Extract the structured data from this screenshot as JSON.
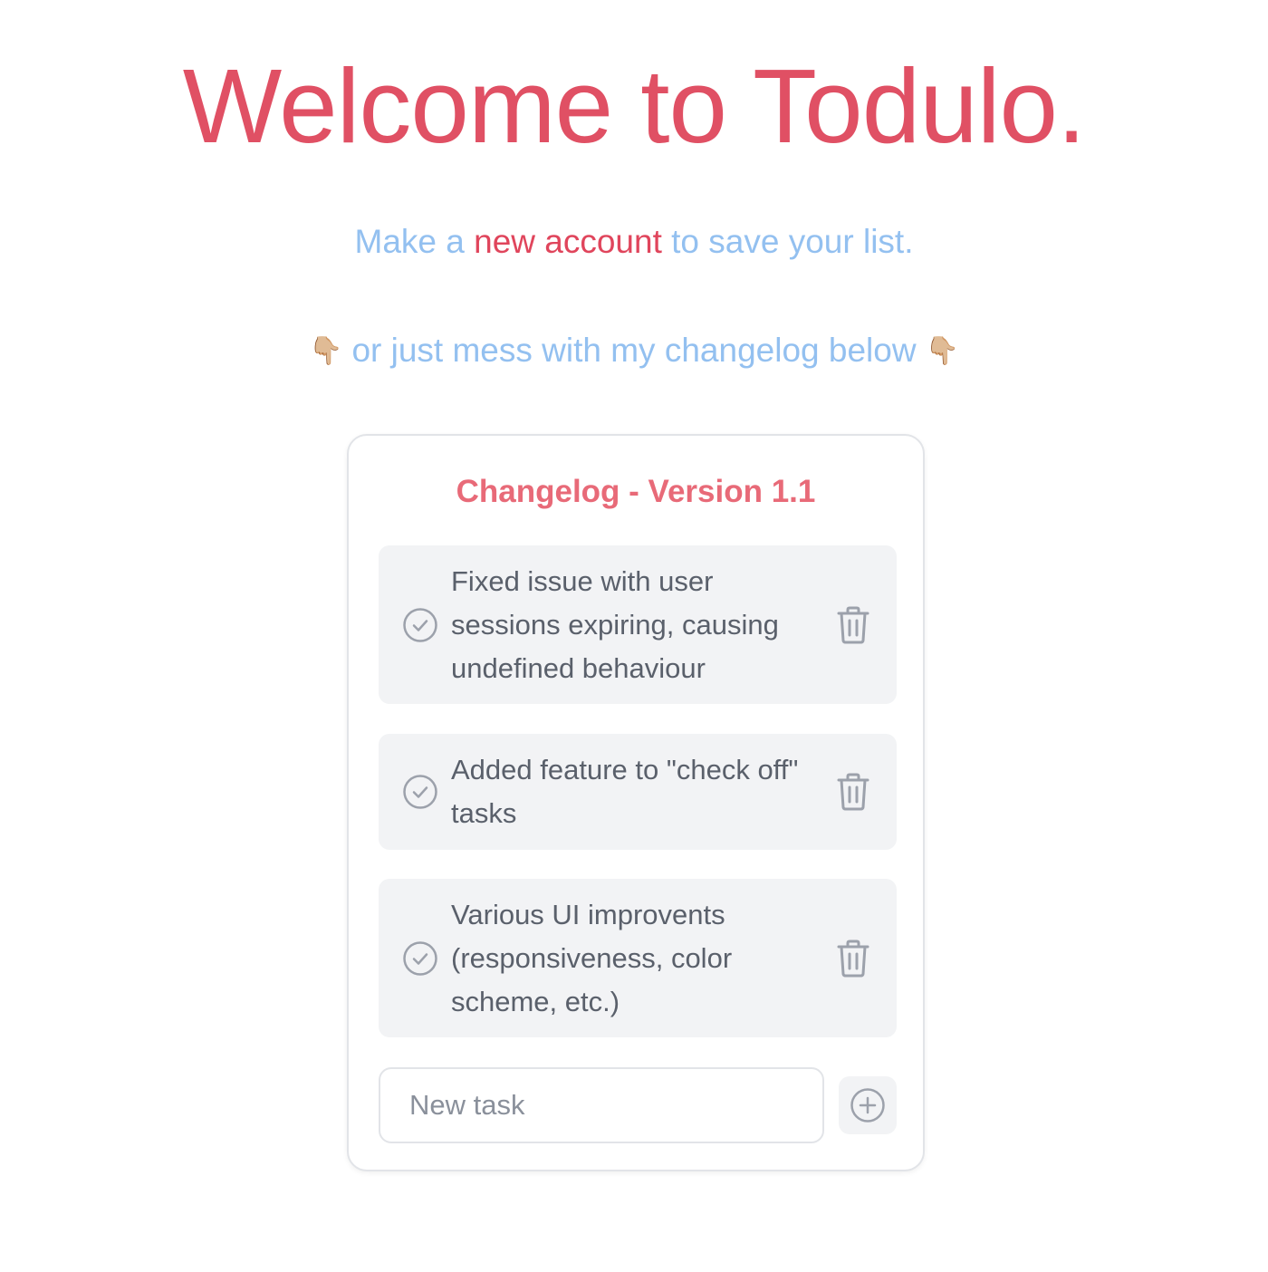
{
  "hero": {
    "title": "Welcome to Todulo."
  },
  "signup": {
    "prefix": "Make a ",
    "link": "new account",
    "suffix": " to save your list."
  },
  "hint": {
    "text": "or just mess with my changelog below",
    "left_emoji": "👇🏼",
    "right_emoji": "👇🏼"
  },
  "changelog": {
    "title": "Changelog - Version 1.1",
    "tasks": [
      {
        "text": "Fixed issue with user sessions expiring, causing undefined behaviour"
      },
      {
        "text": "Added feature to \"check off\" tasks"
      },
      {
        "text": "Various UI improvents (responsiveness, color scheme, etc.)"
      }
    ],
    "new_task_placeholder": "New task",
    "icons": {
      "check": "check-circle-icon",
      "delete": "trash-icon",
      "add": "plus-circle-icon"
    }
  },
  "colors": {
    "accent": "#e05064",
    "subtitle": "#93c0f0",
    "card_title": "#e86a78",
    "task_bg": "#f2f3f5",
    "task_text": "#5a606b",
    "icon": "#9ca1ab"
  }
}
